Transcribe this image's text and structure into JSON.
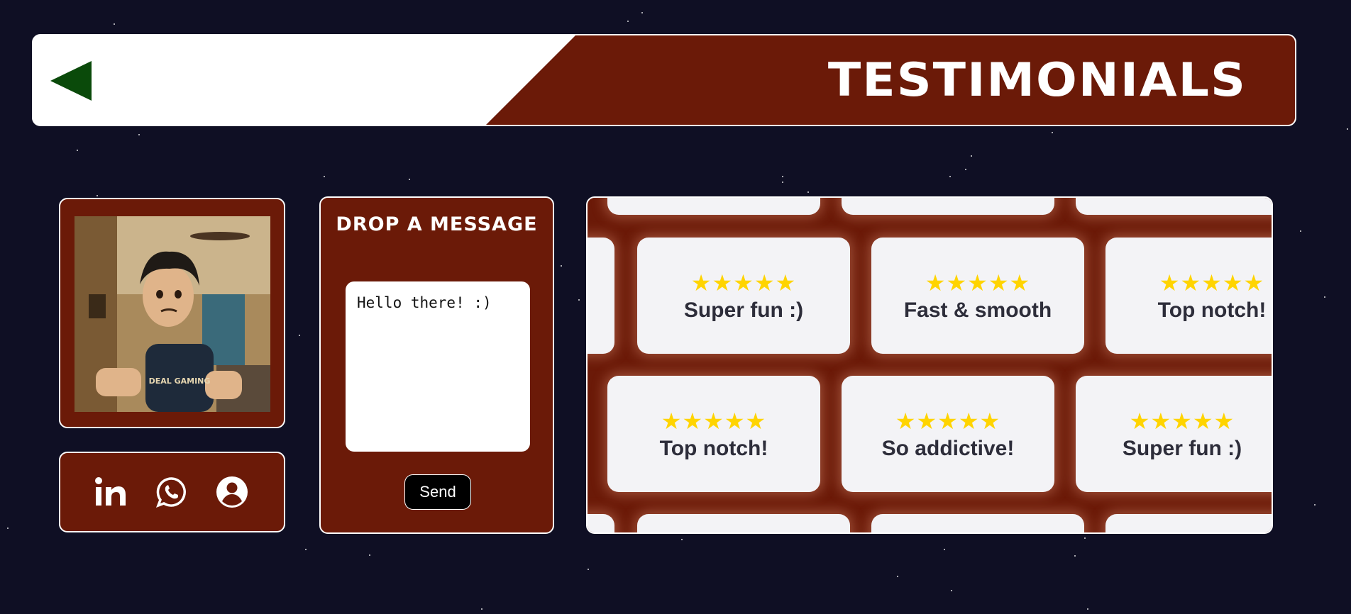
{
  "header": {
    "title": "TESTIMONIALS"
  },
  "message": {
    "title": "DROP A MESSAGE",
    "text": "Hello there! :)",
    "send_label": "Send"
  },
  "social": {
    "icons": [
      "linkedin-icon",
      "whatsapp-icon",
      "profile-icon"
    ]
  },
  "testimonials": {
    "stars": "★★★★★",
    "row1": [
      {
        "label": "Super fun :)"
      },
      {
        "label": "Fast & smooth"
      },
      {
        "label": "Top notch!"
      }
    ],
    "row2": [
      {
        "label": "Top notch!"
      },
      {
        "label": "So addictive!"
      },
      {
        "label": "Super fun :)"
      }
    ]
  },
  "colors": {
    "background": "#0f0f24",
    "panel": "#6b1a08",
    "back_arrow": "#0a4a0a",
    "stars": "#ffd400"
  }
}
